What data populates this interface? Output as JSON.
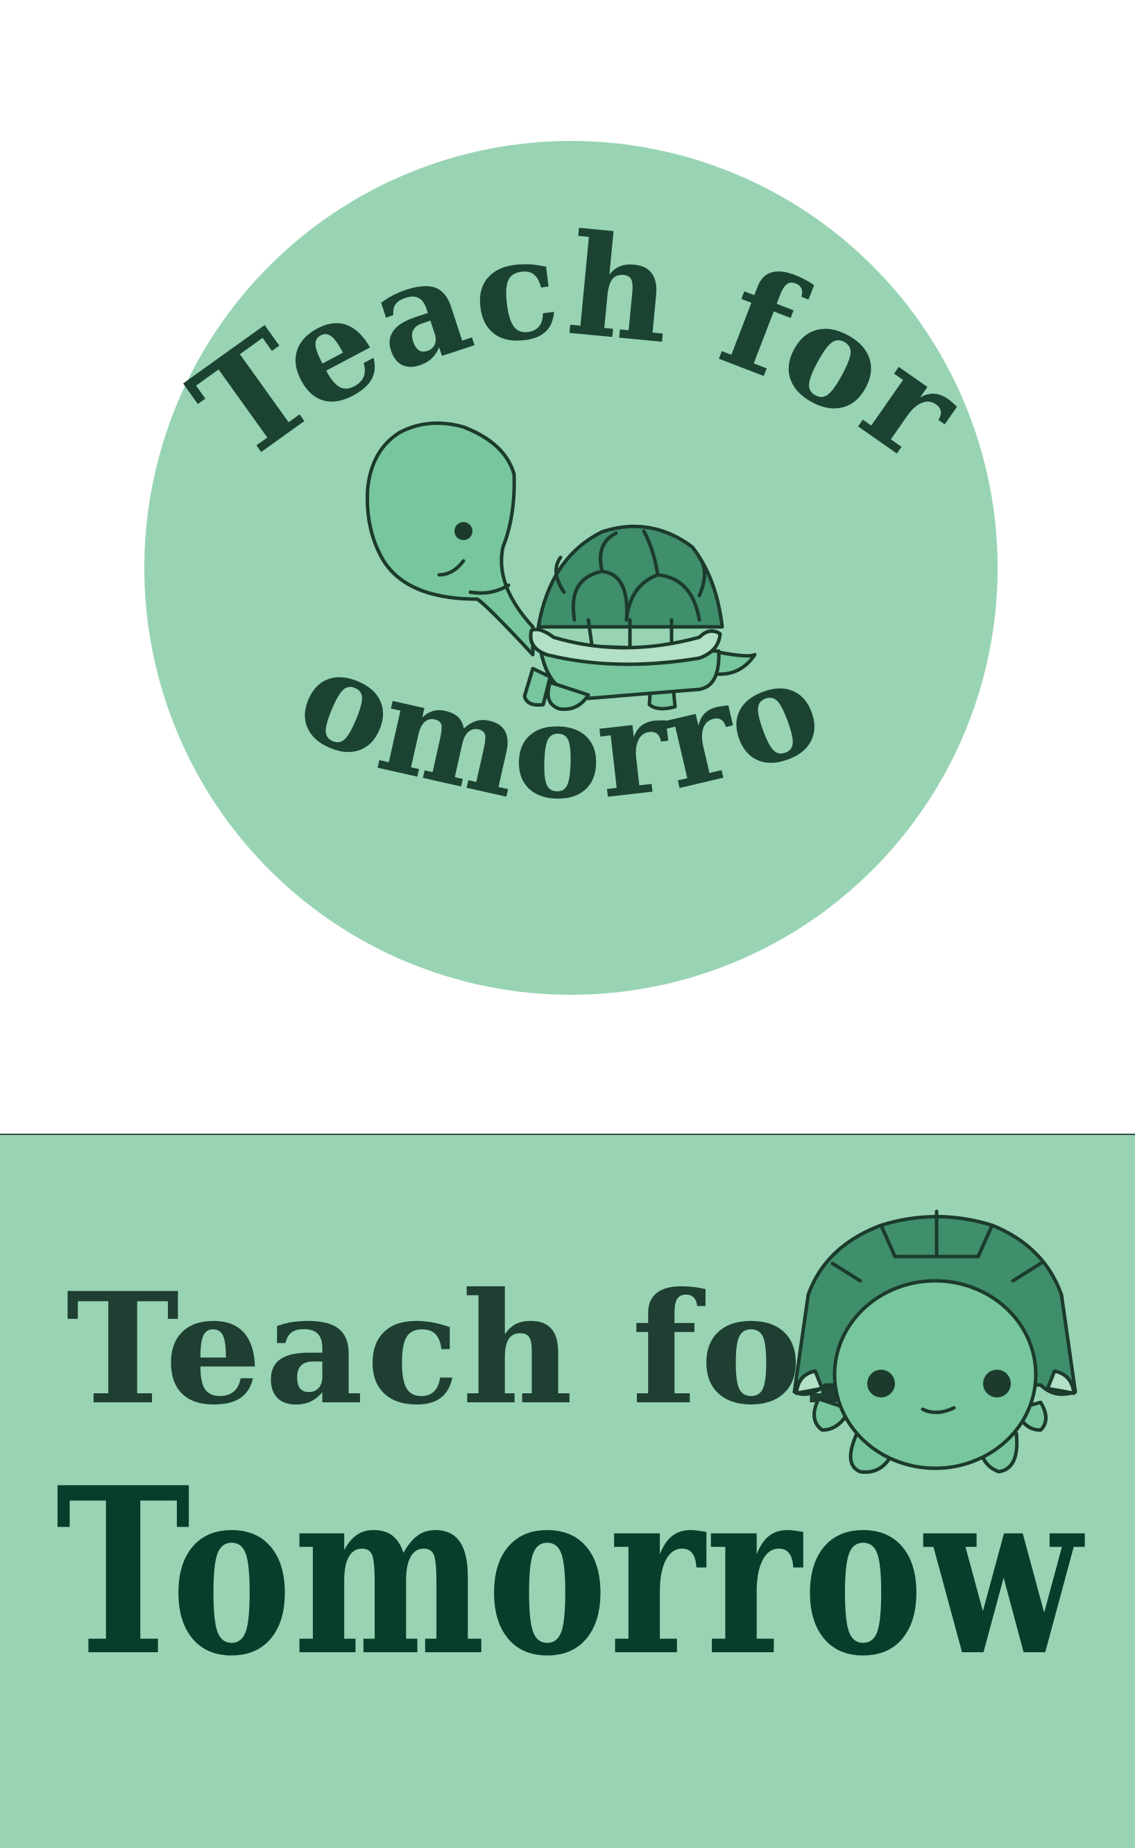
{
  "badge_logo": {
    "line1": "Teach for",
    "line2": "Tomorrow",
    "colors": {
      "badge_fill": "#98d4b4",
      "lettering": "#1c4332",
      "turtle_skin": "#77c69e",
      "turtle_shell": "#3f8e6c",
      "turtle_rim": "#b3e1c7",
      "outline": "#1c3b2c"
    }
  },
  "banner_logo": {
    "line1": "Teach for",
    "line2": "Tomorrow",
    "colors": {
      "banner_fill": "#98d4b4",
      "line1_color": "#1e3f31",
      "line2_color": "#053f2c",
      "turtle_skin": "#77c69e",
      "turtle_shell": "#3f8e6c"
    }
  }
}
